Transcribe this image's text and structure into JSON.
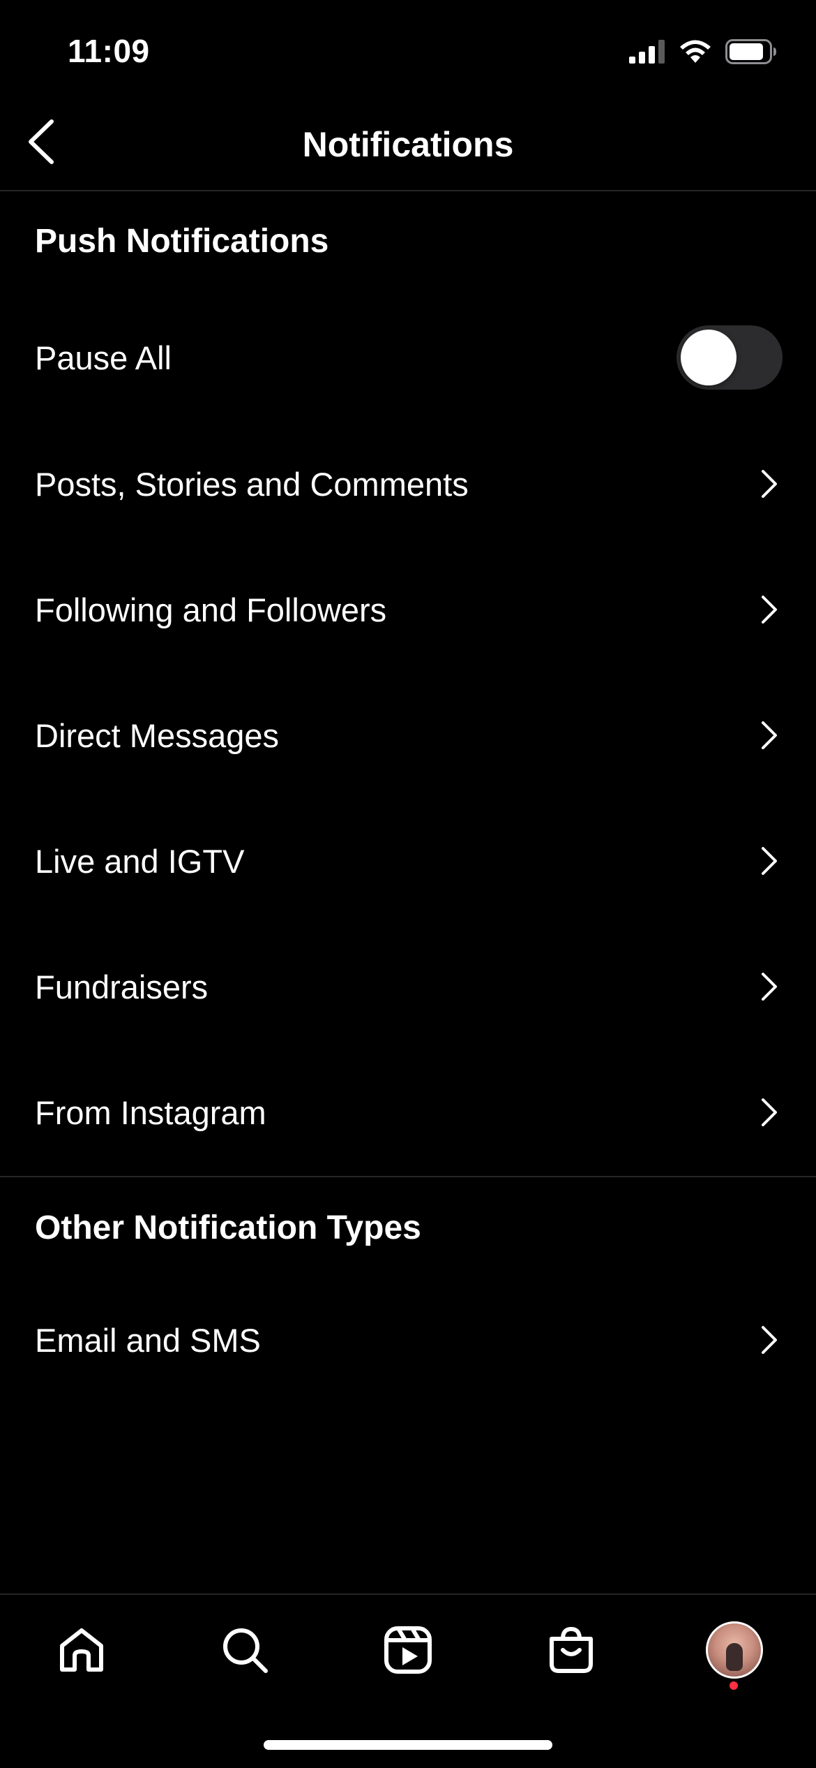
{
  "status_bar": {
    "time": "11:09",
    "icons": [
      "cellular-signal-icon",
      "wifi-icon",
      "battery-icon"
    ]
  },
  "header": {
    "back_icon": "chevron-left-icon",
    "title": "Notifications"
  },
  "push_section": {
    "title": "Push Notifications",
    "pause_all": {
      "label": "Pause All",
      "enabled": false
    },
    "items": [
      {
        "label": "Posts, Stories and Comments"
      },
      {
        "label": "Following and Followers"
      },
      {
        "label": "Direct Messages"
      },
      {
        "label": "Live and IGTV"
      },
      {
        "label": "Fundraisers"
      },
      {
        "label": "From Instagram"
      }
    ]
  },
  "other_section": {
    "title": "Other Notification Types",
    "items": [
      {
        "label": "Email and SMS"
      }
    ]
  },
  "tab_bar": {
    "tabs": [
      "home-icon",
      "search-icon",
      "reels-icon",
      "shop-icon",
      "profile-avatar"
    ],
    "profile_has_notification": true
  },
  "colors": {
    "background": "#000000",
    "text": "#ffffff",
    "divider": "#262626",
    "toggle_off_track": "#2c2c2e",
    "notification_dot": "#ff3040"
  }
}
